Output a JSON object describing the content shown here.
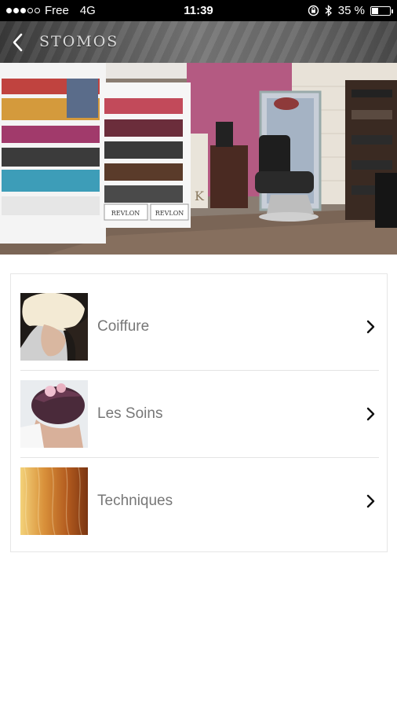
{
  "status_bar": {
    "carrier": "Free",
    "network": "4G",
    "time": "11:39",
    "battery_text": "35 %",
    "battery_level": 0.35
  },
  "header": {
    "title": "STOMOS",
    "back_icon": "chevron-left-icon"
  },
  "hero": {
    "image": "salon-interior-photo",
    "shelf_brand_left": "REVLON",
    "shelf_brand_right": "REVLON",
    "shelf_letter": "K"
  },
  "menu": {
    "items": [
      {
        "label": "Coiffure",
        "thumb": "haircut-photo",
        "icon": "chevron-right-icon"
      },
      {
        "label": "Les Soins",
        "thumb": "hair-care-photo",
        "icon": "chevron-right-icon"
      },
      {
        "label": "Techniques",
        "thumb": "hair-color-photo",
        "icon": "chevron-right-icon"
      }
    ]
  },
  "colors": {
    "status_bar_bg": "#000000",
    "header_bg": "#5a5a5a",
    "label_text": "#777777",
    "divider": "#e4e4e4"
  }
}
